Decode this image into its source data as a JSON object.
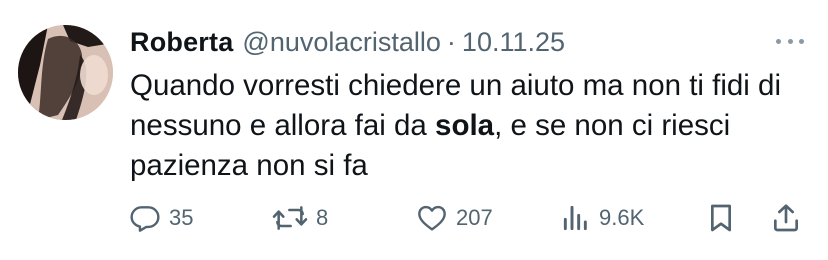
{
  "tweet": {
    "author_name": "Roberta",
    "author_handle": "@nuvolacristallo",
    "separator": "·",
    "date": "10.11.25",
    "text_before": "Quando vorresti chiedere un aiuto ma non ti fidi di nessuno e allora fai da ",
    "text_bold": "sola",
    "text_after": ", e se non ci riesci pazienza non si fa"
  },
  "actions": {
    "replies": "35",
    "retweets": "8",
    "likes": "207",
    "views": "9.6K"
  },
  "icons": {
    "avatar": "avatar-photo",
    "more": "more-icon",
    "reply": "reply-icon",
    "retweet": "retweet-icon",
    "like": "heart-icon",
    "views": "views-icon",
    "bookmark": "bookmark-icon",
    "share": "share-icon"
  },
  "colors": {
    "text": "#0f1419",
    "secondary": "#536471",
    "background": "#ffffff"
  }
}
